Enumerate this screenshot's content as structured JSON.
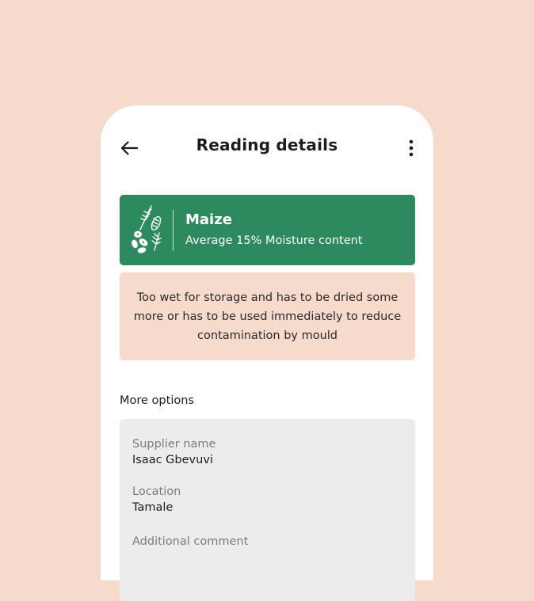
{
  "header": {
    "title": "Reading details",
    "back_icon": "arrow-left-icon",
    "menu_icon": "more-vertical-icon"
  },
  "crop": {
    "icon": "grains-illustration-icon",
    "name": "Maize",
    "subtitle": "Average 15% Moisture content",
    "color": "#2d8a5f"
  },
  "warning": {
    "message": "Too wet for storage and has to be dried some more or has to be used immediately to reduce contamination by mould",
    "color": "#f6dacb"
  },
  "more_options": {
    "label": "More options",
    "fields": [
      {
        "label": "Supplier name",
        "value": "Isaac Gbevuvi"
      },
      {
        "label": "Location",
        "value": "Tamale"
      },
      {
        "label": "Additional comment",
        "value": ""
      }
    ]
  }
}
